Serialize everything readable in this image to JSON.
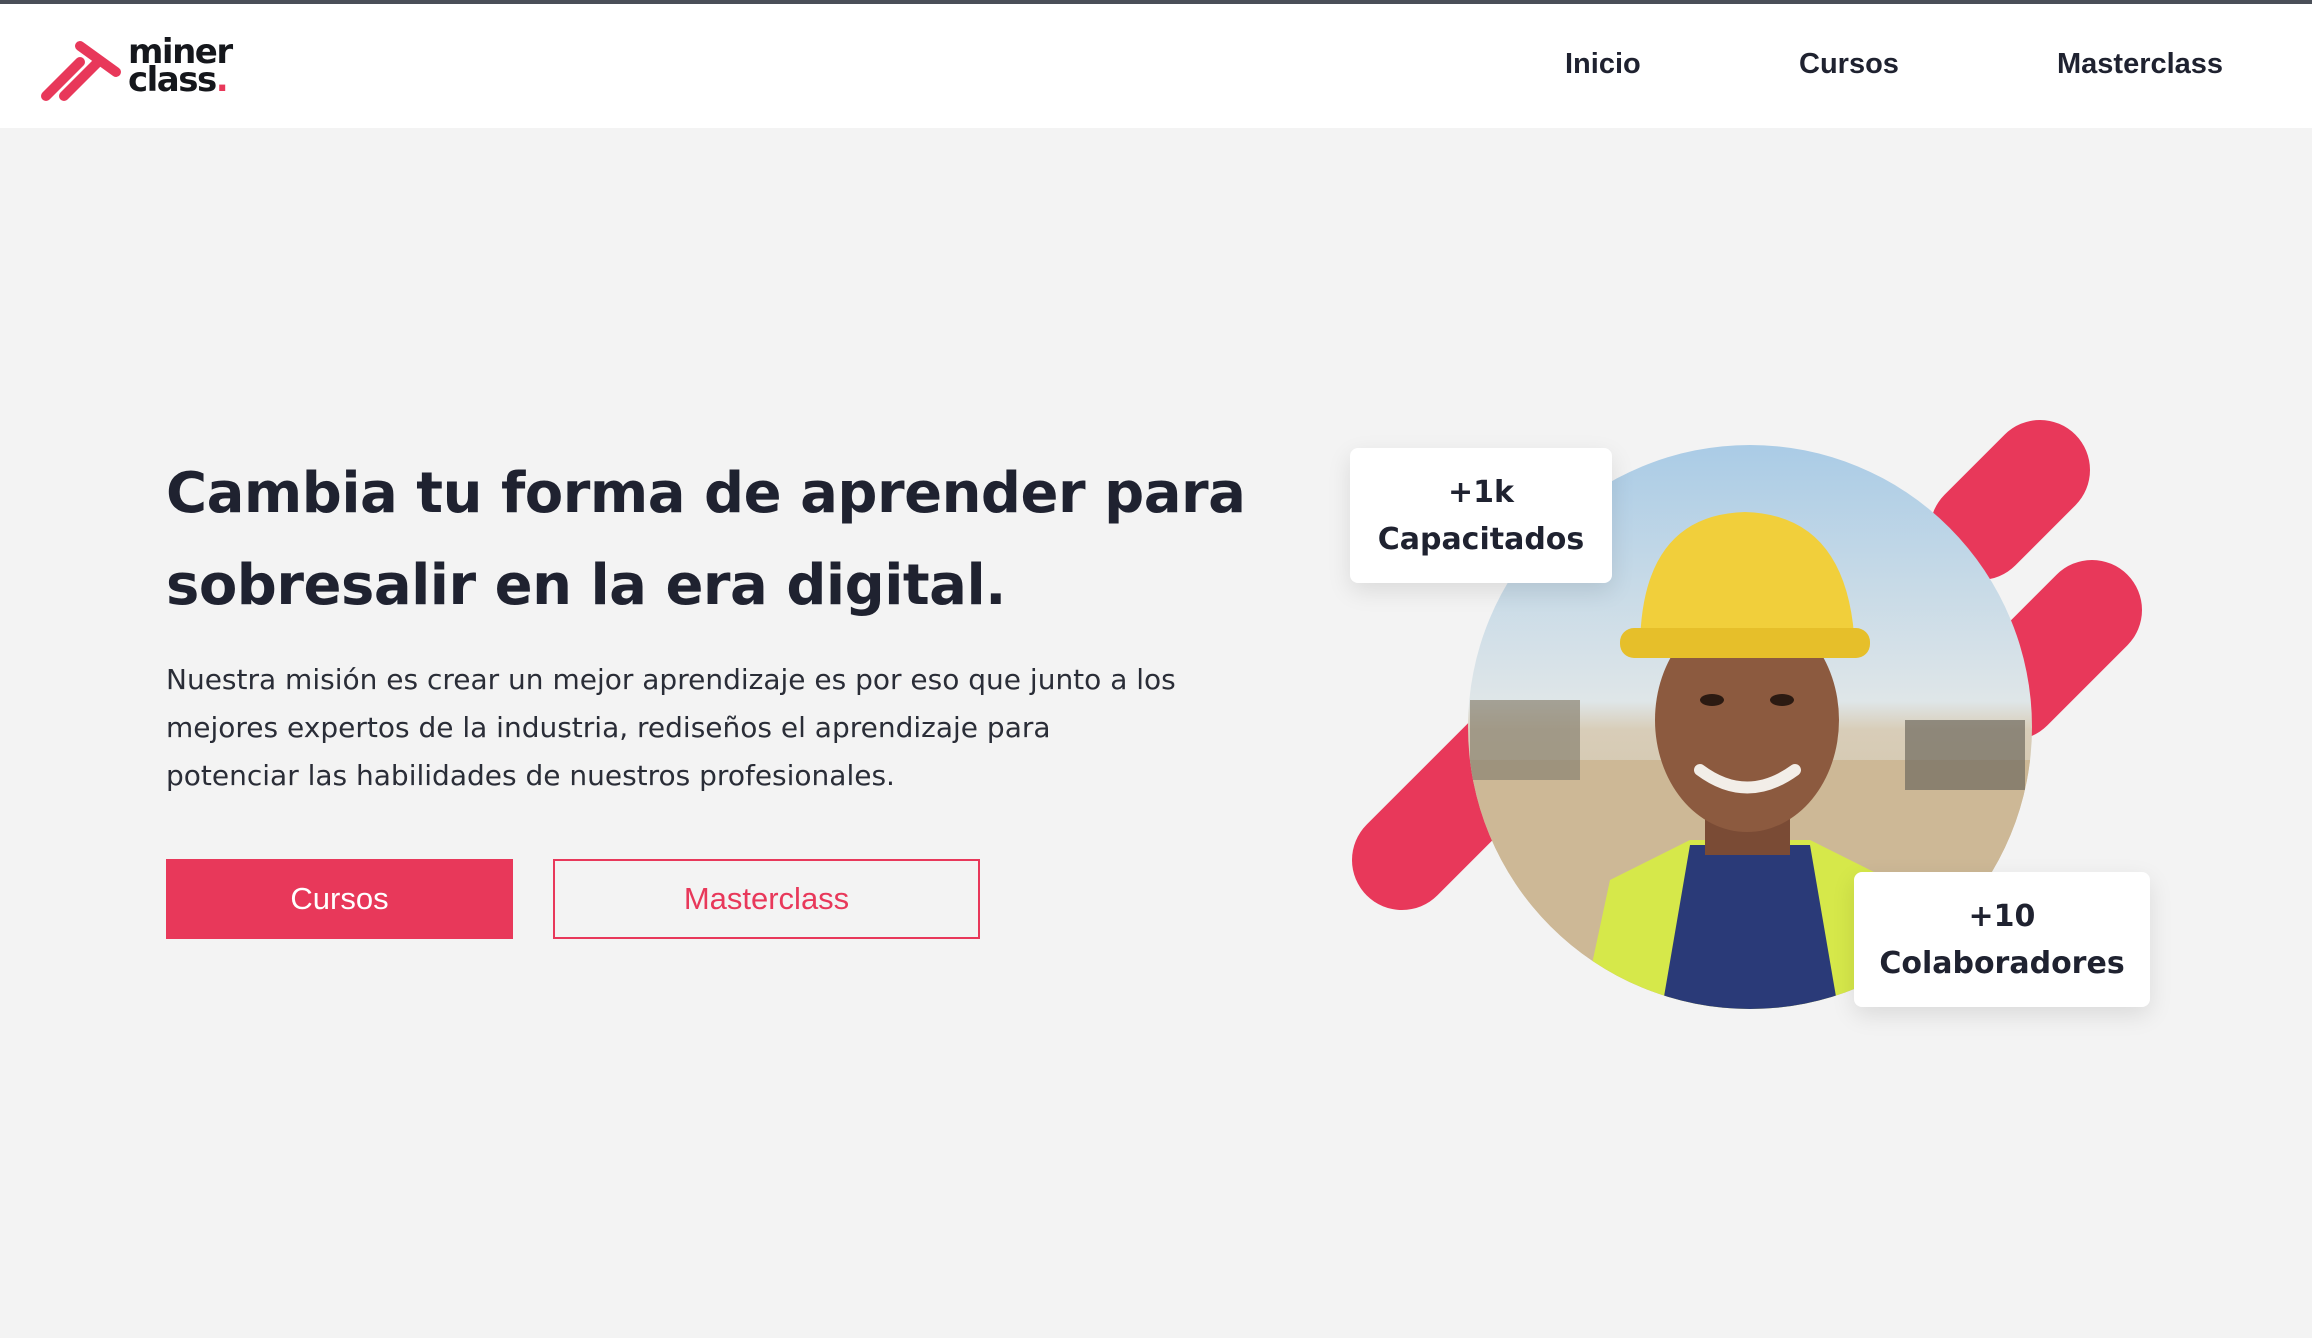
{
  "header": {
    "logo": {
      "line1": "miner",
      "line2": "class",
      "dot": "."
    },
    "nav": {
      "inicio": "Inicio",
      "cursos": "Cursos",
      "masterclass": "Masterclass"
    }
  },
  "hero": {
    "title": "Cambia tu forma de aprender para sobresalir en la era digital.",
    "description": "Nuestra misión es crear un mejor aprendizaje es por eso que junto a los mejores expertos de la industria, rediseños el aprendizaje para potenciar las habilidades de nuestros profesionales.",
    "buttons": {
      "primary": "Cursos",
      "secondary": "Masterclass"
    }
  },
  "stats": [
    {
      "value": "+1k",
      "label": "Capacitados"
    },
    {
      "value": "+10",
      "label": "Colaboradores"
    }
  ],
  "image": {
    "subject": "worker-photo"
  },
  "colors": {
    "accent": "#e8385a",
    "text": "#1f2230",
    "background": "#f3f3f3"
  }
}
